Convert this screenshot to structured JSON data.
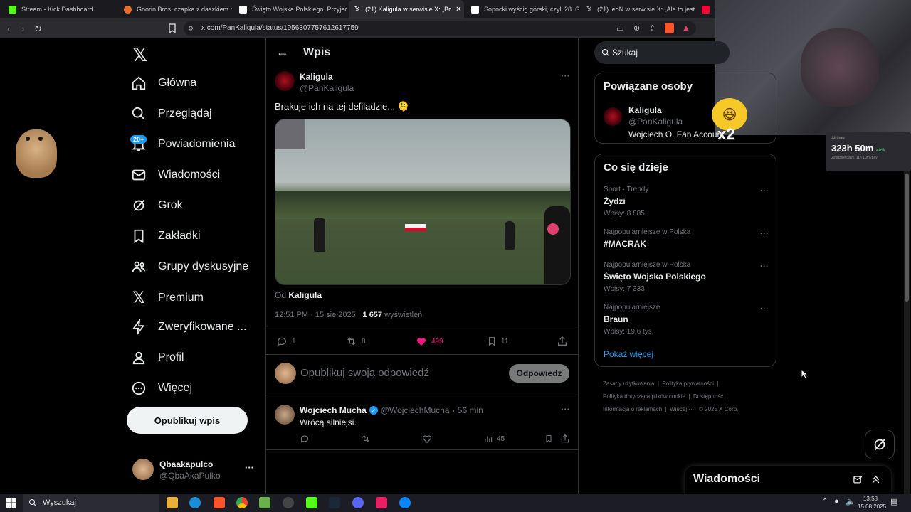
{
  "tabs": [
    {
      "title": "Stream - Kick Dashboard",
      "color": "#53fc18"
    },
    {
      "title": "Goorin Bros. czapka z daszkiem biały",
      "color": "#e8702a"
    },
    {
      "title": "Święto Wojska Polskiego. Przyjedź n",
      "color": "#ffffff"
    },
    {
      "title": "(21) Kaligula w serwisie X: „Br",
      "color": "#ffffff"
    },
    {
      "title": "Sopocki wyścig górski, czyli 28. Gran",
      "color": "#ffffff"
    },
    {
      "title": "(21) leoN w serwisie X: „Ale to jest sz",
      "color": "#ffffff"
    },
    {
      "title": "P",
      "color": "#ff0033"
    }
  ],
  "url": "x.com/PanKaligula/status/1956307757612617759",
  "nav": {
    "home": "Główna",
    "explore": "Przeglądaj",
    "notifications": "Powiadomienia",
    "notif_badge": "20+",
    "messages": "Wiadomości",
    "grok": "Grok",
    "bookmarks": "Zakładki",
    "communities": "Grupy dyskusyjne",
    "premium": "Premium",
    "verified": "Zweryfikowane ...",
    "profile": "Profil",
    "more": "Więcej",
    "post_button": "Opublikuj wpis",
    "account_name": "Qbaakapulco",
    "account_handle": "@QbaAkaPulko",
    "account_more": "···"
  },
  "header": {
    "title": "Wpis"
  },
  "post": {
    "author": "Kaligula",
    "handle": "@PanKaligula",
    "text": "Brakuje ich na tej defiladzie... 🫠",
    "from_label": "Od",
    "from_name": "Kaligula",
    "time": "12:51 PM · 15 sie 2025 · ",
    "views": "1 657",
    "views_label": "wyświetleń",
    "replies": "1",
    "reposts": "8",
    "likes": "499",
    "bookmarks": "11",
    "more": "···"
  },
  "reply_box": {
    "placeholder": "Opublikuj swoją odpowiedź",
    "button": "Odpowiedz"
  },
  "reply": {
    "author": "Wojciech Mucha",
    "handle": "@WojciechMucha",
    "time": "· 56 min",
    "text": "Wrócą silniejsi.",
    "views": "45",
    "more": "···"
  },
  "search": {
    "placeholder": "Szukaj"
  },
  "related": {
    "title": "Powiązane osoby",
    "name": "Kaligula",
    "handle": "@PanKaligula",
    "bio": "Wojciech O. Fan Account"
  },
  "trends": {
    "title": "Co się dzieje",
    "items": [
      {
        "category": "Sport · Trendy",
        "name": "Żydzi",
        "count": "Wpisy: 8 885"
      },
      {
        "category": "Najpopularniejsze w Polska",
        "name": "#MACRAK",
        "count": ""
      },
      {
        "category": "Najpopularniejsze w Polska",
        "name": "Święto Wojska Polskiego",
        "count": "Wpisy: 7 333"
      },
      {
        "category": "Najpopularniejsze",
        "name": "Braun",
        "count": "Wpisy: 19,6 tys."
      }
    ],
    "show_more": "Pokaż więcej"
  },
  "footer": {
    "links": [
      "Zasady użytkowania",
      "Polityka prywatności",
      "Polityka dotycząca plików cookie",
      "Dostępność",
      "Informacja o reklamach",
      "Więcej ···"
    ],
    "copyright": "© 2025 X Corp."
  },
  "messages_drawer": {
    "title": "Wiadomości"
  },
  "overlay": {
    "emote_text": "x2",
    "timer": "323h 50m",
    "timer_label": "Airtime",
    "timer_change": "40%",
    "timer_sub": "29 active days, 11h 10m /day"
  },
  "taskbar": {
    "search": "Wyszukaj",
    "time": "13:58",
    "date": "15.08.2025"
  },
  "colors": {
    "accent": "#1d9bf0",
    "like": "#f91880",
    "background": "#000000",
    "border": "#2f3336"
  }
}
